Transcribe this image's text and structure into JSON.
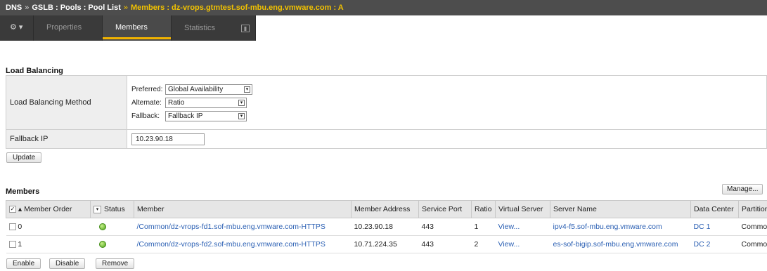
{
  "breadcrumb": {
    "dns": "DNS",
    "sep": "»",
    "gslb": "GSLB : Pools : Pool List",
    "members": "Members : dz-vrops.gtmtest.sof-mbu.eng.vmware.com : A"
  },
  "tabs": {
    "gear": "⚙ ▾",
    "properties": "Properties",
    "members": "Members",
    "statistics": "Statistics"
  },
  "load_balancing": {
    "section_title": "Load Balancing",
    "method_label": "Load Balancing Method",
    "preferred_label": "Preferred:",
    "preferred_value": "Global Availability",
    "alternate_label": "Alternate:",
    "alternate_value": "Ratio",
    "fallback_label": "Fallback:",
    "fallback_value": "Fallback IP",
    "fallback_ip_label": "Fallback IP",
    "fallback_ip_value": "10.23.90.18",
    "update_button": "Update"
  },
  "members": {
    "section_title": "Members",
    "manage_button": "Manage...",
    "columns": {
      "member_order": "Member Order",
      "status": "Status",
      "member": "Member",
      "member_address": "Member Address",
      "service_port": "Service Port",
      "ratio": "Ratio",
      "virtual_server": "Virtual Server",
      "server_name": "Server Name",
      "data_center": "Data Center",
      "partition": "Partition"
    },
    "rows": [
      {
        "order": "0",
        "member": "/Common/dz-vrops-fd1.sof-mbu.eng.vmware.com-HTTPS",
        "address": "10.23.90.18",
        "port": "443",
        "ratio": "1",
        "virtual_server": "View...",
        "server_name": "ipv4-f5.sof-mbu.eng.vmware.com",
        "data_center": "DC 1",
        "partition": "Common"
      },
      {
        "order": "1",
        "member": "/Common/dz-vrops-fd2.sof-mbu.eng.vmware.com-HTTPS",
        "address": "10.71.224.35",
        "port": "443",
        "ratio": "2",
        "virtual_server": "View...",
        "server_name": "es-sof-bigip.sof-mbu.eng.vmware.com",
        "data_center": "DC 2",
        "partition": "Common"
      }
    ],
    "enable_button": "Enable",
    "disable_button": "Disable",
    "remove_button": "Remove"
  },
  "colors": {
    "accent": "#f2b300",
    "link": "#2a5fb3",
    "status_available": "#4ea31a"
  }
}
